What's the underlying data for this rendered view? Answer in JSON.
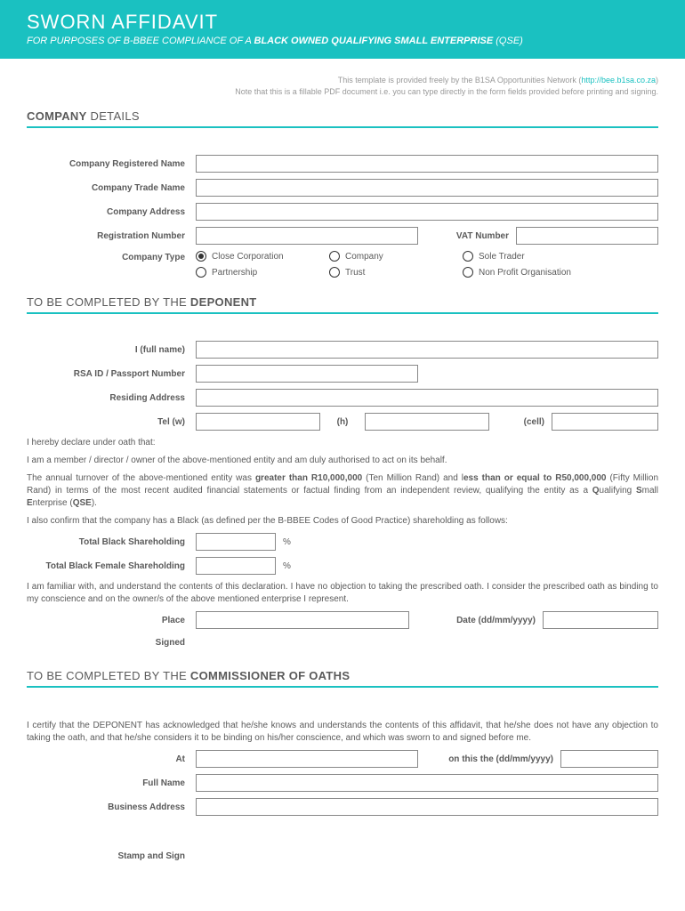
{
  "header": {
    "title": "SWORN AFFIDAVIT",
    "subtitle_prefix": "FOR PURPOSES OF B-BBEE COMPLIANCE OF A ",
    "subtitle_bold": "BLACK OWNED QUALIFYING SMALL ENTERPRISE",
    "subtitle_suffix": " (QSE)"
  },
  "note": {
    "line1_prefix": "This template is provided freely by the B1SA Opportunities Network (",
    "line1_link": "http://bee.b1sa.co.za",
    "line1_suffix": ")",
    "line2": "Note that this is a fillable PDF document i.e. you can type directly in the form fields provided before printing and signing."
  },
  "sections": {
    "company": {
      "bold": "COMPANY",
      "light": " DETAILS"
    },
    "deponent": {
      "light": "TO BE COMPLETED BY THE ",
      "bold": "DEPONENT"
    },
    "commissioner": {
      "light": "TO BE COMPLETED BY THE ",
      "bold": "COMMISSIONER OF OATHS"
    }
  },
  "company": {
    "registered_name_label": "Company Registered Name",
    "trade_name_label": "Company Trade Name",
    "address_label": "Company Address",
    "reg_number_label": "Registration Number",
    "vat_label": "VAT Number",
    "type_label": "Company Type",
    "types": {
      "close_corp": "Close Corporation",
      "company": "Company",
      "sole_trader": "Sole Trader",
      "partnership": "Partnership",
      "trust": "Trust",
      "npo": "Non Profit Organisation"
    }
  },
  "deponent": {
    "full_name_label": "I (full name)",
    "rsa_id_label": "RSA ID / Passport Number",
    "residing_label": "Residing Address",
    "tel_w_label": "Tel (w)",
    "tel_h_label": "(h)",
    "tel_cell_label": "(cell)",
    "declare": "I hereby declare under oath that:",
    "member_text": "I am a member / director / owner of the above-mentioned entity and am duly authorised to act on its behalf.",
    "turnover_p1": "The annual turnover of the above-mentioned entity was ",
    "turnover_b1": "greater than R10,000,000",
    "turnover_p2": " (Ten Million Rand) and l",
    "turnover_b2": "ess than or equal to R50,000,000",
    "turnover_p3": " (Fifty Million Rand) in terms of the most recent audited financial statements or factual finding from an independent review, qualifying the entity as a ",
    "turnover_b3a": "Q",
    "turnover_p3a": "ualifying ",
    "turnover_b3b": "S",
    "turnover_p3b": "mall ",
    "turnover_b3c": "E",
    "turnover_p3c": "nterprise (",
    "turnover_b3d": "QSE",
    "turnover_p3d": ").",
    "confirm_text": "I also confirm that the company has a Black (as defined per the B-BBEE Codes of Good Practice) shareholding as follows:",
    "total_black_label": "Total Black Shareholding",
    "total_black_female_label": "Total Black Female Shareholding",
    "percent": "%",
    "familiar_text": "I am familiar with, and understand the contents of this declaration. I have no objection to taking the prescribed oath. I consider the prescribed oath as binding to my conscience and on the owner/s of the above mentioned enterprise I represent.",
    "place_label": "Place",
    "date_label": "Date (dd/mm/yyyy)",
    "signed_label": "Signed"
  },
  "commissioner": {
    "certify_text": "I certify that the DEPONENT has acknowledged that he/she knows and understands the contents of this affidavit, that he/she does not have any objection to taking the oath, and that he/she considers it to be binding on his/her conscience, and which was sworn to and signed before me.",
    "at_label": "At",
    "on_this_label": "on this the (dd/mm/yyyy)",
    "full_name_label": "Full Name",
    "business_address_label": "Business Address",
    "stamp_label": "Stamp and Sign"
  }
}
